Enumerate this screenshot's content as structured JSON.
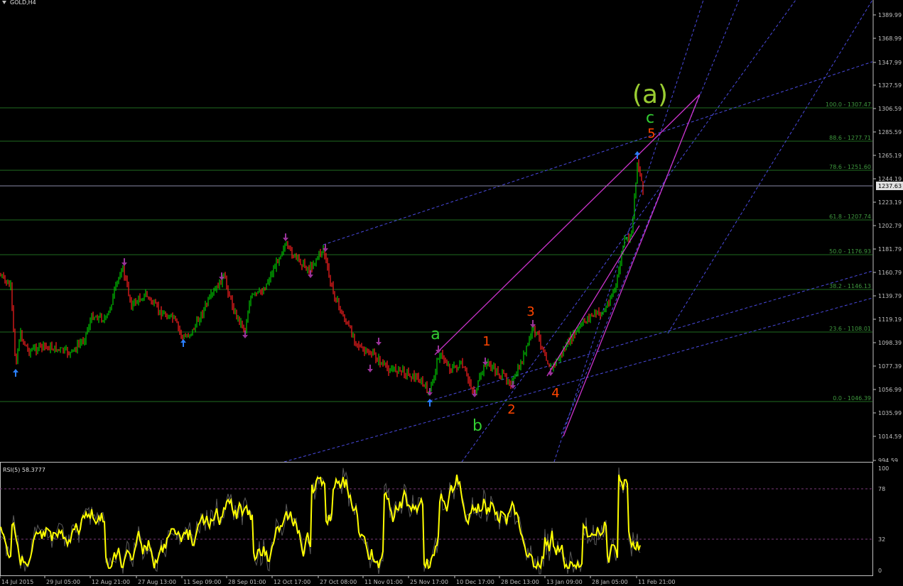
{
  "window": {
    "title": "GOLD,H4"
  },
  "main": {
    "price_axis_labels": [
      "1389.99",
      "1368.99",
      "1347.99",
      "1327.59",
      "1306.59",
      "1285.59",
      "1265.19",
      "1244.19",
      "1223.19",
      "1202.79",
      "1181.79",
      "1160.79",
      "1139.79",
      "1119.19",
      "1098.39",
      "1077.39",
      "1056.99",
      "1035.99",
      "1014.59",
      "994.59"
    ],
    "current_price": "1237.63",
    "fib_levels": [
      {
        "label": "100.0 - 1307.47",
        "price": 1307.47
      },
      {
        "label": "88.6 - 1277.71",
        "price": 1277.71
      },
      {
        "label": "78.6 - 1251.60",
        "price": 1251.6
      },
      {
        "label": "61.8 - 1207.74",
        "price": 1207.74
      },
      {
        "label": "50.0 - 1176.93",
        "price": 1176.93
      },
      {
        "label": "38.2 - 1146.13",
        "price": 1146.13
      },
      {
        "label": "23.6 - 1108.01",
        "price": 1108.01
      },
      {
        "label": "0.0 - 1046.39",
        "price": 1046.39
      }
    ],
    "wave_labels": [
      {
        "text": "(a)",
        "color": "#9acd32"
      },
      {
        "text": "c",
        "color": "#32cd32"
      },
      {
        "text": "5",
        "color": "#ff4500"
      },
      {
        "text": "a",
        "color": "#32cd32"
      },
      {
        "text": "b",
        "color": "#32cd32"
      },
      {
        "text": "1",
        "color": "#ff4500"
      },
      {
        "text": "2",
        "color": "#ff4500"
      },
      {
        "text": "3",
        "color": "#ff4500"
      },
      {
        "text": "4",
        "color": "#ff4500"
      }
    ],
    "colors": {
      "bull": "#00c800",
      "bear": "#ff2020",
      "fib": "#1f6b1f",
      "channel": "#cc33cc",
      "dash": "#4a4ae0",
      "arrow_up": "#2a7fff",
      "arrow_down": "#993399"
    }
  },
  "rsi": {
    "title": "RSI(5) 58.3777",
    "levels": [
      "100",
      "78",
      "32",
      "0"
    ],
    "line_color": "#ffff00"
  },
  "time_axis": {
    "labels": [
      "14 Jul 2015",
      "29 Jul 05:00",
      "12 Aug 21:00",
      "27 Aug 13:00",
      "11 Sep 09:00",
      "28 Sep 01:00",
      "12 Oct 17:00",
      "27 Oct 08:00",
      "11 Nov 01:00",
      "25 Nov 17:00",
      "10 Dec 17:00",
      "28 Dec 13:00",
      "13 Jan 09:00",
      "28 Jan 05:00",
      "11 Feb 21:00"
    ]
  }
}
